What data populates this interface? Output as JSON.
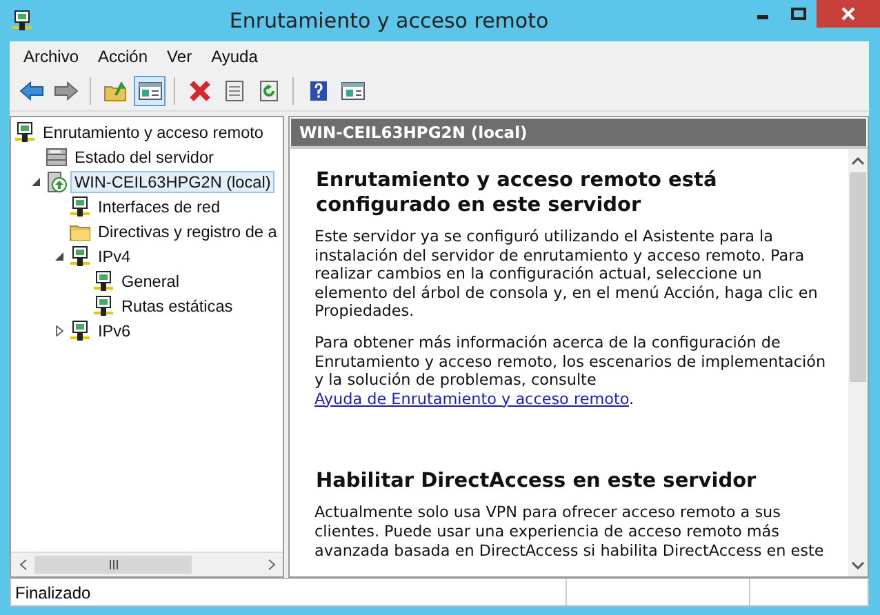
{
  "window": {
    "title": "Enrutamiento y acceso remoto"
  },
  "menu": [
    "Archivo",
    "Acción",
    "Ver",
    "Ayuda"
  ],
  "toolbar": [
    {
      "kind": "back",
      "pressed": false
    },
    {
      "kind": "forward",
      "pressed": false
    },
    {
      "kind": "sep"
    },
    {
      "kind": "up",
      "pressed": false
    },
    {
      "kind": "tree",
      "pressed": true
    },
    {
      "kind": "sep"
    },
    {
      "kind": "delete",
      "pressed": false
    },
    {
      "kind": "properties",
      "pressed": false
    },
    {
      "kind": "refresh",
      "pressed": false
    },
    {
      "kind": "sep"
    },
    {
      "kind": "help",
      "pressed": false
    },
    {
      "kind": "actionpane",
      "pressed": false
    }
  ],
  "tree": [
    {
      "label": "Enrutamiento y acceso remoto",
      "kind": "network",
      "selected": false,
      "children": [
        {
          "label": "Estado del servidor",
          "kind": "status",
          "selected": false
        },
        {
          "label": "WIN-CEIL63HPG2N (local)",
          "kind": "server",
          "selected": true,
          "expanded": true,
          "children": [
            {
              "label": "Interfaces de red",
              "kind": "network",
              "selected": false
            },
            {
              "label": "Directivas y registro de a",
              "kind": "folder",
              "selected": false
            },
            {
              "label": "IPv4",
              "kind": "network",
              "selected": false,
              "expanded": true,
              "children": [
                {
                  "label": "General",
                  "kind": "network",
                  "selected": false
                },
                {
                  "label": "Rutas estáticas",
                  "kind": "network",
                  "selected": false
                }
              ]
            },
            {
              "label": "IPv6",
              "kind": "network",
              "selected": false,
              "expanded": false
            }
          ]
        }
      ]
    }
  ],
  "content": {
    "header": "WIN-CEIL63HPG2N (local)",
    "sections": [
      {
        "heading": "Enrutamiento y acceso remoto está configurado en este servidor",
        "paragraphs": [
          {
            "text": "Este servidor ya se configuró utilizando el Asistente para la instalación del servidor de enrutamiento y acceso remoto. Para realizar cambios en la configuración actual, seleccione un elemento del árbol de consola y, en el menú Acción, haga clic en Propiedades."
          },
          {
            "text": "Para obtener más información acerca de la configuración de Enrutamiento y acceso remoto, los escenarios de implementación y la solución de problemas, consulte ",
            "link": "Ayuda de Enrutamiento y acceso remoto",
            "after": "."
          }
        ]
      },
      {
        "heading": "Habilitar DirectAccess en este servidor",
        "paragraphs": [
          {
            "text": "Actualmente solo usa VPN para ofrecer acceso remoto a sus clientes. Puede usar una experiencia de acceso remoto más avanzada basada en DirectAccess si habilita DirectAccess en este"
          }
        ]
      }
    ]
  },
  "status_bar": [
    "Finalizado"
  ]
}
